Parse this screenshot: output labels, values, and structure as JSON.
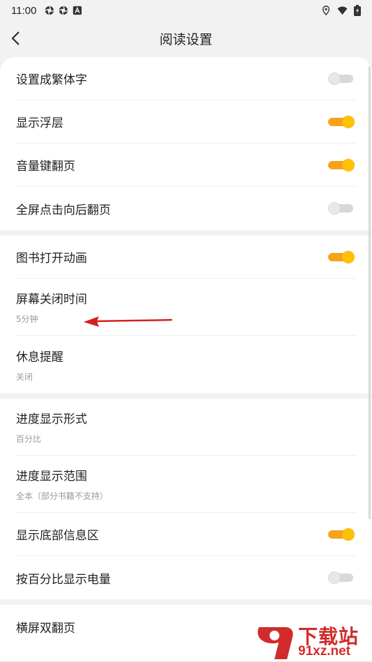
{
  "status_bar": {
    "time": "11:00",
    "left_icons": [
      "aperture-icon",
      "aperture-icon",
      "font-a-icon"
    ],
    "right_icons": [
      "location-icon",
      "wifi-icon",
      "battery-icon"
    ]
  },
  "header": {
    "title": "阅读设置",
    "back_icon": "chevron-left-icon"
  },
  "groups": [
    {
      "items": [
        {
          "label": "设置成繁体字",
          "toggle": false
        },
        {
          "label": "显示浮层",
          "toggle": true
        },
        {
          "label": "音量键翻页",
          "toggle": true
        },
        {
          "label": "全屏点击向后翻页",
          "toggle": false
        }
      ]
    },
    {
      "items": [
        {
          "label": "图书打开动画",
          "toggle": true
        },
        {
          "label": "屏幕关闭时间",
          "sub": "5分钟"
        },
        {
          "label": "休息提醒",
          "sub": "关闭"
        }
      ]
    },
    {
      "items": [
        {
          "label": "进度显示形式",
          "sub": "百分比"
        },
        {
          "label": "进度显示范围",
          "sub": "全本（部分书籍不支持）"
        },
        {
          "label": "显示底部信息区",
          "toggle": true
        },
        {
          "label": "按百分比显示电量",
          "toggle": false
        }
      ]
    },
    {
      "items": [
        {
          "label": "横屏双翻页"
        }
      ]
    }
  ],
  "colors": {
    "toggle_on_track": "#f7a21b",
    "toggle_on_knob": "#ffc107",
    "toggle_off": "#d8d8d8",
    "page_bg": "#f2f2f2",
    "annotation_arrow": "#d42020",
    "watermark": "#d22b2b"
  },
  "watermark": {
    "title": "下载站",
    "url": "91xz.net"
  }
}
